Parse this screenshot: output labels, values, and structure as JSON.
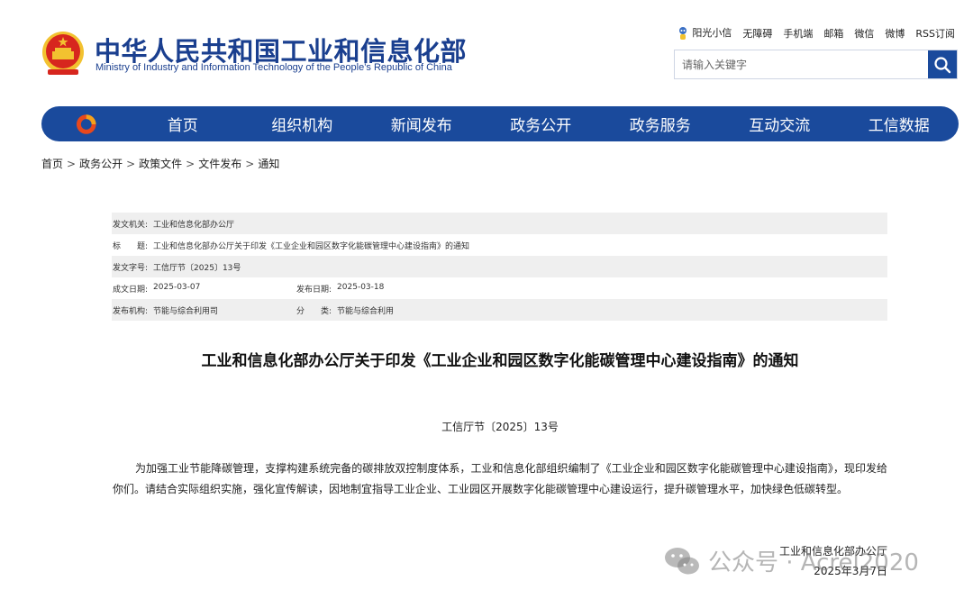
{
  "header": {
    "title": "中华人民共和国工业和信息化部",
    "subtitle": "Ministry of Industry and Information Technology of the People’s Republic of China",
    "links": [
      "阳光小信",
      "无障碍",
      "手机端",
      "邮箱",
      "微信",
      "微博",
      "RSS订阅"
    ],
    "search_placeholder": "请输入关键字"
  },
  "nav": {
    "items": [
      "首页",
      "组织机构",
      "新闻发布",
      "政务公开",
      "政务服务",
      "互动交流",
      "工信数据"
    ]
  },
  "breadcrumb": [
    "首页",
    "政务公开",
    "政策文件",
    "文件发布",
    "通知"
  ],
  "meta": {
    "issuer_label": "发文机关:",
    "issuer": "工业和信息化部办公厅",
    "title_label": "标　　题:",
    "title": "工业和信息化部办公厅关于印发《工业企业和园区数字化能碳管理中心建设指南》的通知",
    "doc_no_label": "发文字号:",
    "doc_no": "工信厅节〔2025〕13号",
    "created_label": "成文日期:",
    "created": "2025-03-07",
    "published_label": "发布日期:",
    "published": "2025-03-18",
    "agency_label": "发布机构:",
    "agency": "节能与综合利用司",
    "category_label": "分　　类:",
    "category": "节能与综合利用"
  },
  "document": {
    "title": "工业和信息化部办公厅关于印发《工业企业和园区数字化能碳管理中心建设指南》的通知",
    "number": "工信厅节〔2025〕13号",
    "body": "为加强工业节能降碳管理，支撑构建系统完备的碳排放双控制度体系，工业和信息化部组织编制了《工业企业和园区数字化能碳管理中心建设指南》，现印发给你们。请结合实际组织实施，强化宣传解读，因地制宜指导工业企业、工业园区开展数字化能碳管理中心建设运行，提升碳管理水平，加快绿色低碳转型。",
    "signature": "工业和信息化部办公厅",
    "date": "2025年3月7日"
  },
  "watermark": {
    "text": "公众号 · Acrel2020"
  },
  "colors": {
    "brand_blue": "#1a4a9c",
    "title_blue": "#1a3f8f",
    "emblem_red": "#d7261e",
    "emblem_gold": "#f2c230"
  }
}
